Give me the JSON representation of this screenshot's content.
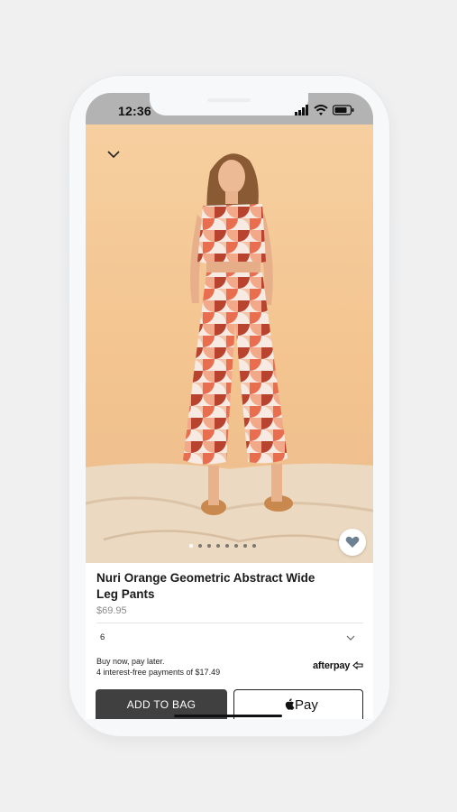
{
  "status_bar": {
    "time": "12:36"
  },
  "hero": {
    "collapse_icon": "chevron-down-icon",
    "image_count": 8,
    "active_image": 1,
    "favorite_icon": "heart-icon"
  },
  "product": {
    "title": "Nuri Orange Geometric Abstract Wide Leg Pants",
    "price": "$69.95",
    "size": "6"
  },
  "afterpay": {
    "line1": "Buy now, pay later.",
    "line2": "4 interest-free payments of $17.49",
    "logo_text": "afterpay"
  },
  "actions": {
    "add_to_bag": "ADD TO BAG",
    "pay_label": "Pay"
  },
  "colors": {
    "backdrop": "#f5c896",
    "button_dark": "#404040",
    "status_bar": "#b3b3b3"
  }
}
